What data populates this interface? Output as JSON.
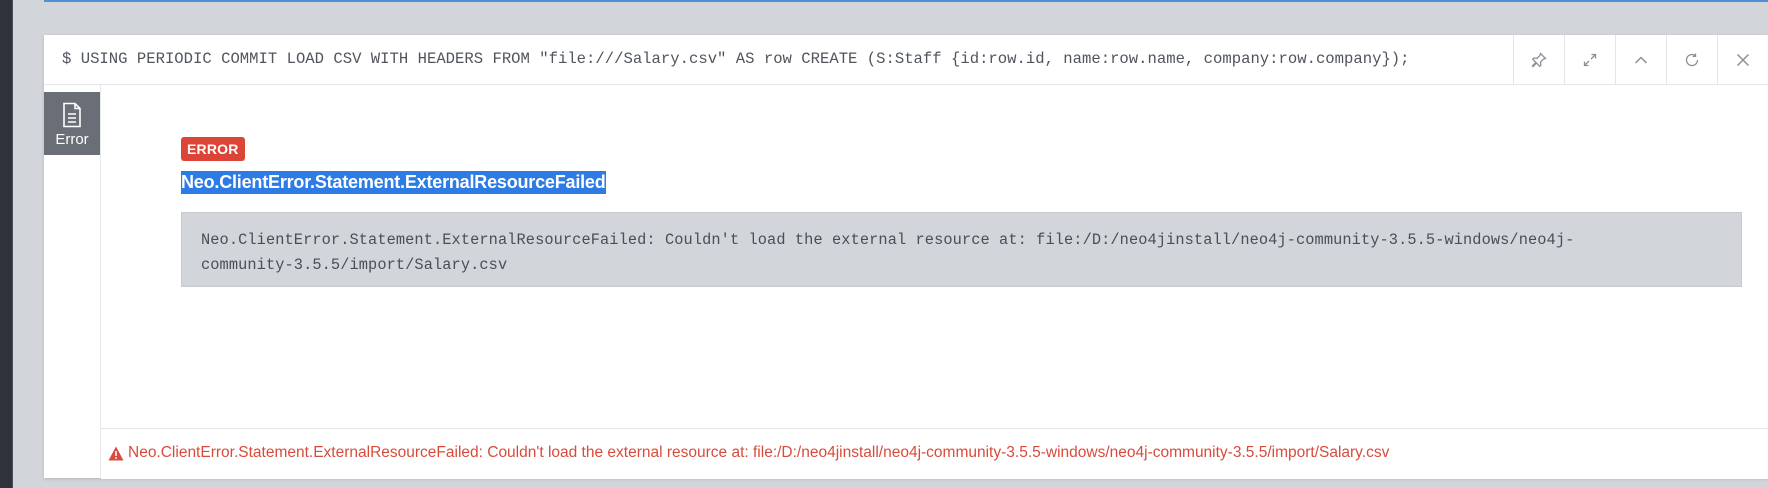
{
  "command": {
    "prompt": "$",
    "query": "USING PERIODIC COMMIT LOAD CSV WITH HEADERS FROM \"file:///Salary.csv\" AS row CREATE (S:Staff {id:row.id, name:row.name, company:row.company});"
  },
  "actions": [
    {
      "icon": "pin-icon"
    },
    {
      "icon": "expand-icon"
    },
    {
      "icon": "collapse-icon"
    },
    {
      "icon": "rerun-icon"
    },
    {
      "icon": "close-icon"
    }
  ],
  "side_tab": {
    "label": "Error",
    "icon": "document-icon"
  },
  "error": {
    "badge": "ERROR",
    "code": "Neo.ClientError.Statement.ExternalResourceFailed",
    "message_line1": "Neo.ClientError.Statement.ExternalResourceFailed: Couldn't load the external resource at: file:/D:/neo4jinstall/neo4j-community-3.5.5-windows/neo4j-",
    "message_line2": "community-3.5.5/import/Salary.csv"
  },
  "footer": {
    "icon": "warning-icon",
    "message": "Neo.ClientError.Statement.ExternalResourceFailed: Couldn't load the external resource at: file:/D:/neo4jinstall/neo4j-community-3.5.5-windows/neo4j-community-3.5.5/import/Salary.csv"
  },
  "colors": {
    "error_badge": "#db4437",
    "selection": "#2d7be5",
    "footer_text": "#d84b3c",
    "accent": "#4e8fd6"
  }
}
